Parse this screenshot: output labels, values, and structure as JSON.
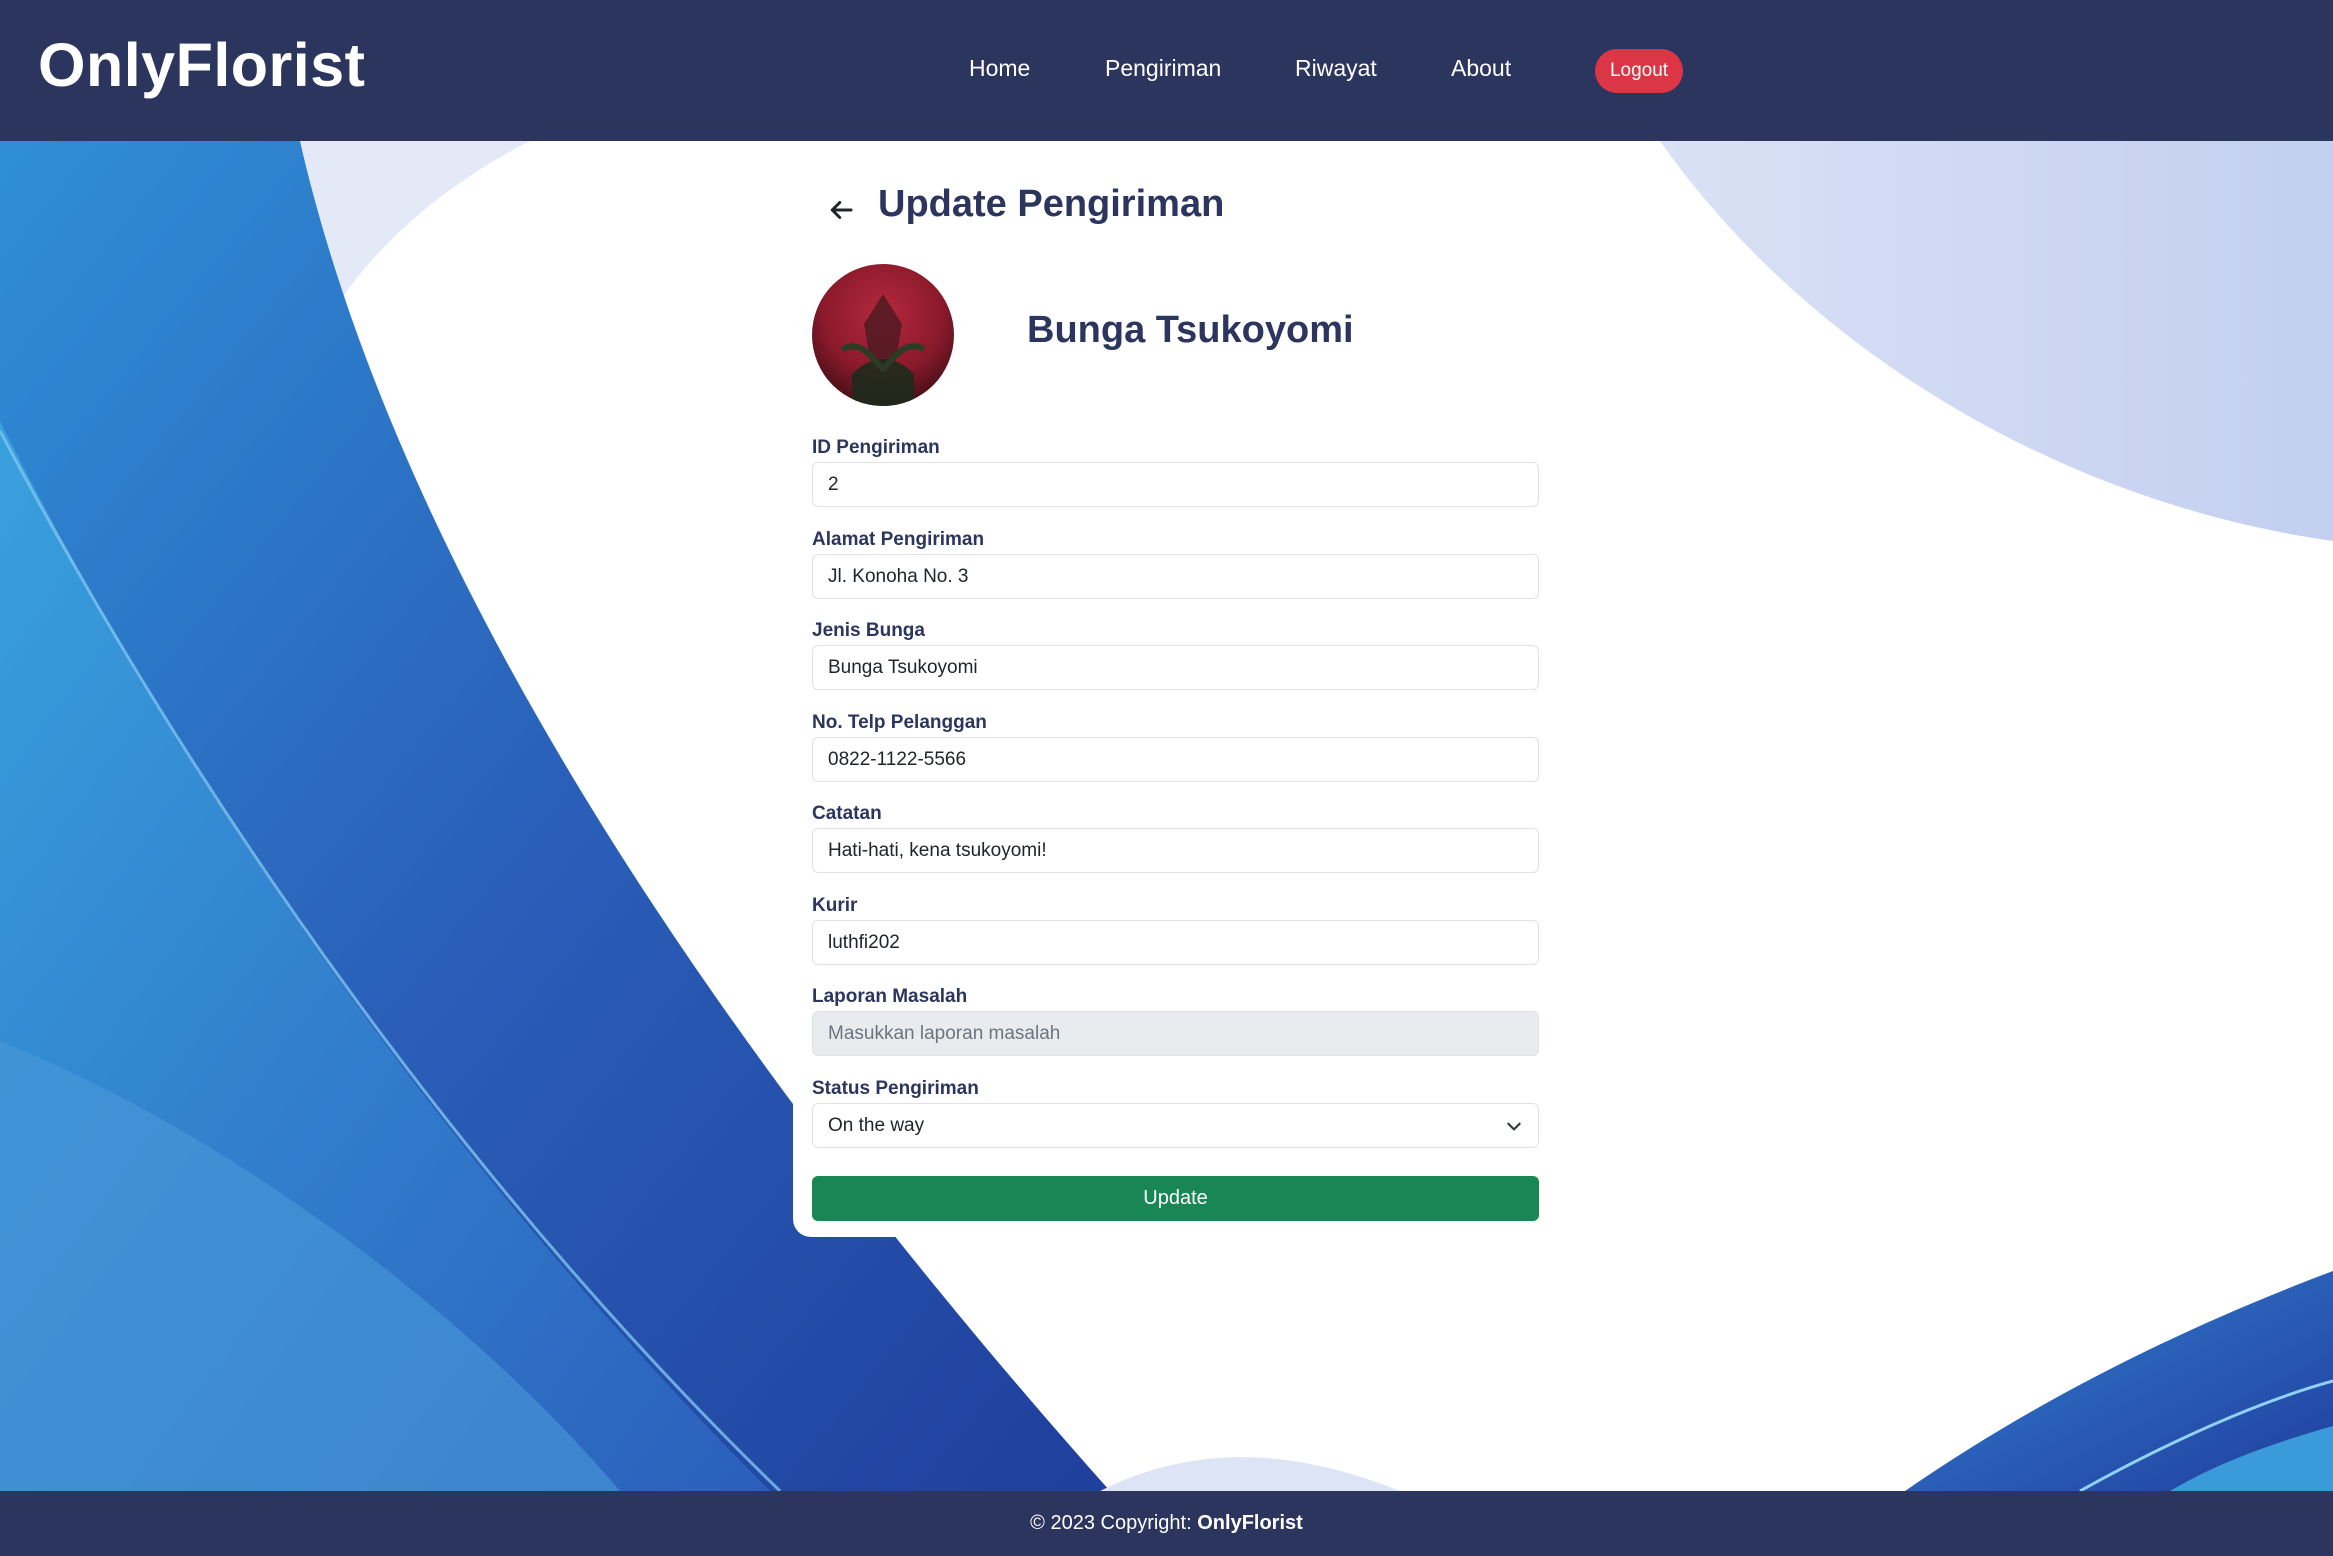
{
  "navbar": {
    "brand": "OnlyFlorist",
    "links": [
      "Home",
      "Pengiriman",
      "Riwayat",
      "About"
    ],
    "logout_label": "Logout",
    "colors": {
      "background": "#2b355e",
      "logout": "#dc3545"
    }
  },
  "page": {
    "title": "Update Pengiriman",
    "back_icon": "arrow-left-icon"
  },
  "product": {
    "name": "Bunga Tsukoyomi"
  },
  "form": {
    "fields": [
      {
        "label": "ID Pengiriman",
        "value": "2"
      },
      {
        "label": "Alamat Pengiriman",
        "value": "Jl. Konoha No. 3"
      },
      {
        "label": "Jenis Bunga",
        "value": "Bunga Tsukoyomi"
      },
      {
        "label": "No. Telp Pelanggan",
        "value": "0822-1122-5566"
      },
      {
        "label": "Catatan",
        "value": "Hati-hati, kena tsukoyomi!"
      },
      {
        "label": "Kurir",
        "value": "luthfi202"
      },
      {
        "label": "Laporan Masalah",
        "value": "",
        "placeholder": "Masukkan laporan masalah"
      }
    ],
    "status": {
      "label": "Status Pengiriman",
      "selected": "On the way"
    },
    "submit_label": "Update",
    "colors": {
      "submit": "#198754"
    }
  },
  "footer": {
    "prefix": "© 2023 Copyright: ",
    "brand": "OnlyFlorist"
  }
}
